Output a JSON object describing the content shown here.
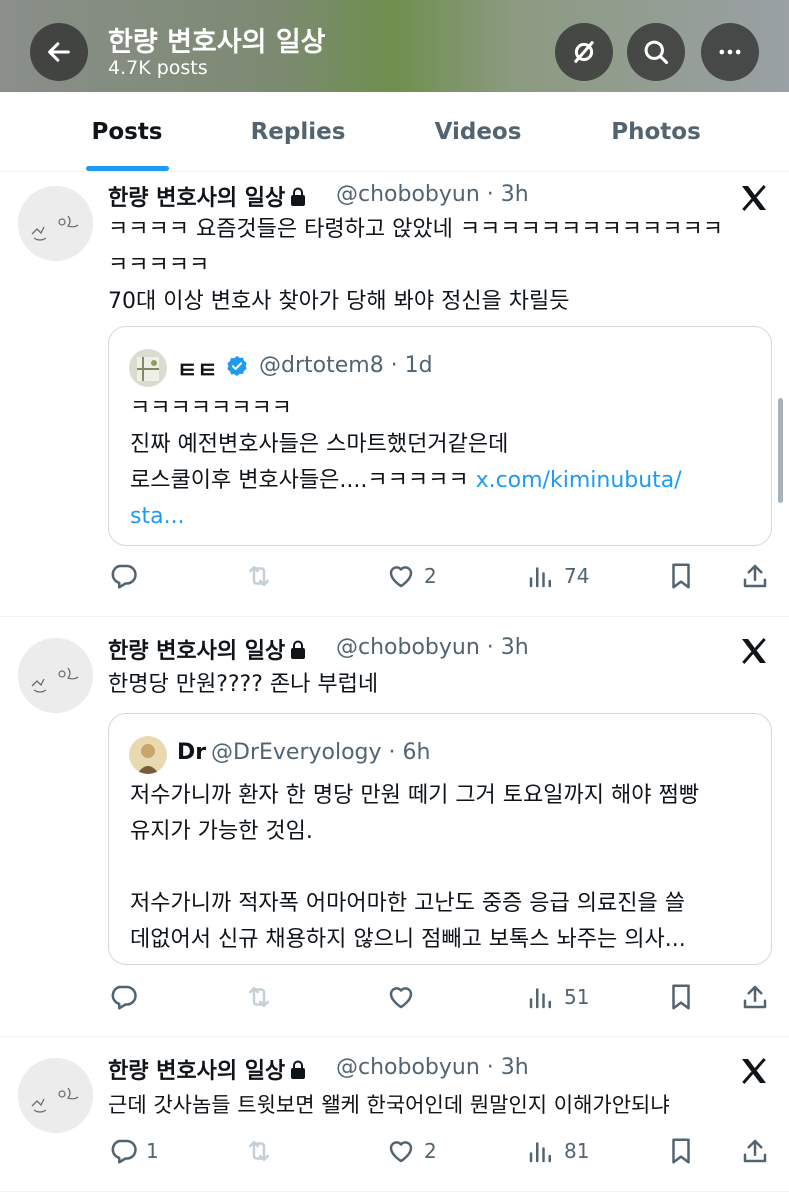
{
  "header": {
    "title": "한량 변호사의 일상",
    "post_count": "4.7K posts",
    "icons": [
      "back-arrow-icon",
      "grok-icon",
      "search-icon",
      "more-icon"
    ]
  },
  "tabs": [
    {
      "label": "Posts",
      "active": true
    },
    {
      "label": "Replies",
      "active": false
    },
    {
      "label": "Videos",
      "active": false
    },
    {
      "label": "Photos",
      "active": false
    }
  ],
  "posts": [
    {
      "author": "한량 변호사의 일상",
      "meta": "@chobobyun · 3h",
      "text": "ㅋㅋㅋㅋ 요즘것들은 타령하고 앉았네 ㅋㅋㅋㅋㅋㅋㅋㅋㅋㅋㅋㅋㅋ\nㅋㅋㅋㅋㅋ\n70대 이상 변호사 찾아가 당해 봐야 정신을 차릴듯",
      "quote": {
        "name": "ㅌㅌ",
        "verified": true,
        "meta": "@drtotem8 · 1d",
        "text": "ㅋㅋㅋㅋㅋㅋㅋㅋ\n진짜 예전변호사들은 스마트했던거같은데\n로스쿨이후 변호사들은....ㅋㅋㅋㅋㅋ ",
        "link_line1": "x.com/kiminubuta/",
        "link_line2": "sta..."
      },
      "reply_count": "",
      "retweet_count": "",
      "like_count": "2",
      "view_count": "74"
    },
    {
      "author": "한량 변호사의 일상",
      "meta": "@chobobyun · 3h",
      "text": "한명당 만원???? 존나 부럽네",
      "quote": {
        "name": "Dr",
        "verified": false,
        "meta": "@DrEveryology · 6h",
        "text": "저수가니까 환자 한 명당 만원 떼기 그거 토요일까지 해야 쩜빵\n유지가 가능한 것임.\n\n저수가니까 적자폭 어마어마한 고난도 중증 응급 의료진을 쓸\n데없어서 신규 채용하지 않으니 점빼고 보톡스 놔주는 의사..."
      },
      "reply_count": "",
      "retweet_count": "",
      "like_count": "",
      "view_count": "51"
    },
    {
      "author": "한량 변호사의 일상",
      "meta": "@chobobyun · 3h",
      "text": "근데 갓사놈들 트윗보면 왤케 한국어인데 뭔말인지 이해가안되냐",
      "reply_count": "1",
      "retweet_count": "",
      "like_count": "2",
      "view_count": "81"
    }
  ],
  "colors": {
    "accent": "#1d9bf0",
    "secondary_text": "#536471",
    "border": "#cfd9de"
  }
}
